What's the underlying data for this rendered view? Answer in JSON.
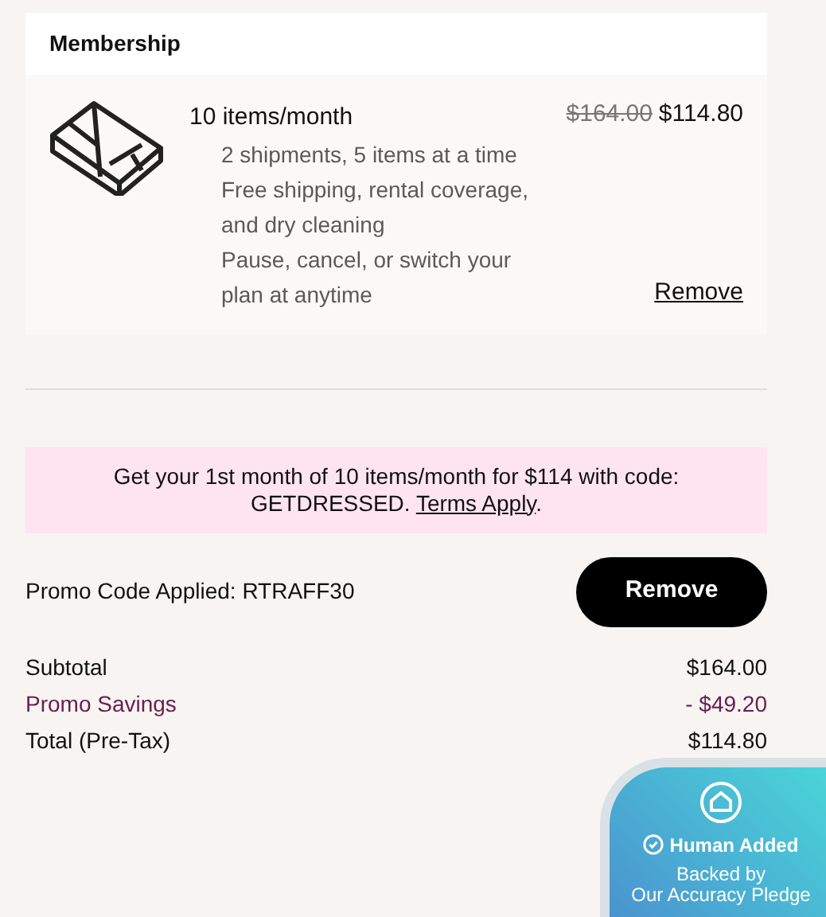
{
  "membership": {
    "title": "Membership",
    "plan": "10 items/month",
    "features": [
      "2 shipments, 5 items at a time",
      "Free shipping, rental coverage, and dry cleaning",
      "Pause, cancel, or switch your plan at anytime"
    ],
    "original_price": "$164.00",
    "price": "$114.80",
    "remove": "Remove"
  },
  "promo_banner": {
    "text": "Get your 1st month of 10 items/month for $114 with code: GETDRESSED.",
    "link": "Terms Apply",
    "after": "."
  },
  "promo_code": {
    "label": "Promo Code Applied: RTRAFF30",
    "button": "Remove"
  },
  "summary": [
    {
      "label": "Subtotal",
      "value": "$164.00",
      "kind": "normal"
    },
    {
      "label": "Promo Savings",
      "value": "- $49.20",
      "kind": "savings"
    },
    {
      "label": "Total (Pre-Tax)",
      "value": "$114.80",
      "kind": "normal"
    }
  ],
  "badge": {
    "title": "Human Added",
    "subtitle": "Backed by",
    "subtitle2": "Our Accuracy Pledge"
  }
}
